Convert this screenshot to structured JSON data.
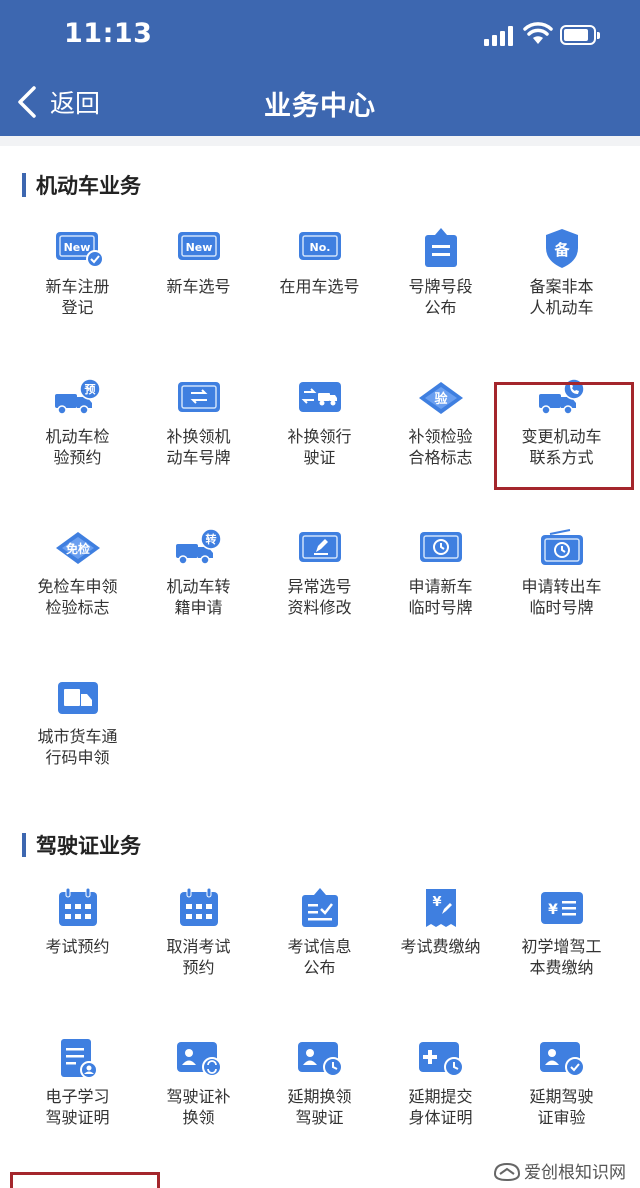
{
  "status_bar": {
    "time": "11:13"
  },
  "nav": {
    "back_label": "返回",
    "title": "业务中心"
  },
  "colors": {
    "header": "#3d67b0",
    "icon_blue": "#3f7fe0",
    "icon_light": "#cfe2fb",
    "highlight": "#a4262c"
  },
  "sections": [
    {
      "title": "机动车业务",
      "items": [
        {
          "label": "新车注册\n登记",
          "icon": "new-plate-check-icon"
        },
        {
          "label": "新车选号",
          "icon": "new-plate-icon"
        },
        {
          "label": "在用车选号",
          "icon": "number-plate-icon"
        },
        {
          "label": "号牌号段\n公布",
          "icon": "announcement-board-icon"
        },
        {
          "label": "备案非本\n人机动车",
          "icon": "record-shield-icon"
        },
        {
          "label": "机动车检\n验预约",
          "icon": "truck-reservation-icon"
        },
        {
          "label": "补换领机\n动车号牌",
          "icon": "plate-exchange-icon"
        },
        {
          "label": "补换领行\n驶证",
          "icon": "license-exchange-icon"
        },
        {
          "label": "补领检验\n合格标志",
          "icon": "inspection-badge-icon"
        },
        {
          "label": "变更机动车\n联系方式",
          "icon": "truck-phone-icon"
        },
        {
          "label": "免检车申领\n检验标志",
          "icon": "exempt-badge-icon"
        },
        {
          "label": "机动车转\n籍申请",
          "icon": "truck-transfer-icon"
        },
        {
          "label": "异常选号\n资料修改",
          "icon": "plate-edit-icon"
        },
        {
          "label": "申请新车\n临时号牌",
          "icon": "temp-plate-clock-icon"
        },
        {
          "label": "申请转出车\n临时号牌",
          "icon": "radio-plate-clock-icon"
        },
        {
          "label": "城市货车通\n行码申领",
          "icon": "cargo-truck-icon"
        }
      ]
    },
    {
      "title": "驾驶证业务",
      "items": [
        {
          "label": "考试预约",
          "icon": "calendar-icon"
        },
        {
          "label": "取消考试\n预约",
          "icon": "calendar-cancel-icon"
        },
        {
          "label": "考试信息\n公布",
          "icon": "info-board-icon"
        },
        {
          "label": "考试费缴纳",
          "icon": "fee-receipt-icon"
        },
        {
          "label": "初学增驾工\n本费缴纳",
          "icon": "fee-card-icon"
        },
        {
          "label": "电子学习\n驾驶证明",
          "icon": "document-user-icon"
        },
        {
          "label": "驾驶证补\n换领",
          "icon": "id-card-exchange-icon"
        },
        {
          "label": "延期换领\n驾驶证",
          "icon": "id-card-clock-icon"
        },
        {
          "label": "延期提交\n身体证明",
          "icon": "medical-clock-icon"
        },
        {
          "label": "延期驾驶\n证审验",
          "icon": "id-card-check-icon"
        }
      ]
    }
  ],
  "watermark": {
    "text": "爱创根知识网"
  }
}
